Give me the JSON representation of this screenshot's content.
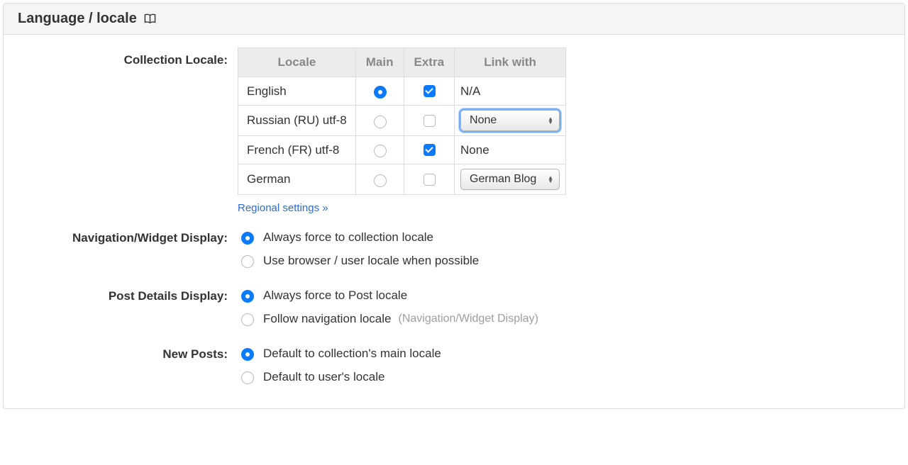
{
  "header": {
    "title": "Language / locale"
  },
  "labels": {
    "collection_locale": "Collection Locale:",
    "nav_widget_display": "Navigation/Widget Display:",
    "post_details_display": "Post Details Display:",
    "new_posts": "New Posts:"
  },
  "table": {
    "headers": {
      "locale": "Locale",
      "main": "Main",
      "extra": "Extra",
      "link_with": "Link with"
    },
    "rows": [
      {
        "locale": "English",
        "main": true,
        "extra": true,
        "link_type": "na",
        "link": "N/A"
      },
      {
        "locale": "Russian (RU) utf-8",
        "main": false,
        "extra": false,
        "link_type": "select",
        "link": "None",
        "focused": true
      },
      {
        "locale": "French (FR) utf-8",
        "main": false,
        "extra": true,
        "link_type": "text",
        "link": "None"
      },
      {
        "locale": "German",
        "main": false,
        "extra": false,
        "link_type": "select",
        "link": "German Blog"
      }
    ]
  },
  "regional_settings_link": "Regional settings »",
  "nav_widget": {
    "selected": "force",
    "options": {
      "force": "Always force to collection locale",
      "browser": "Use browser / user locale when possible"
    }
  },
  "post_details": {
    "selected": "force",
    "options": {
      "force": "Always force to Post locale",
      "follow": "Follow navigation locale",
      "follow_hint": "(Navigation/Widget Display)"
    }
  },
  "new_posts": {
    "selected": "collection",
    "options": {
      "collection": "Default to collection's main locale",
      "user": "Default to user's locale"
    }
  }
}
